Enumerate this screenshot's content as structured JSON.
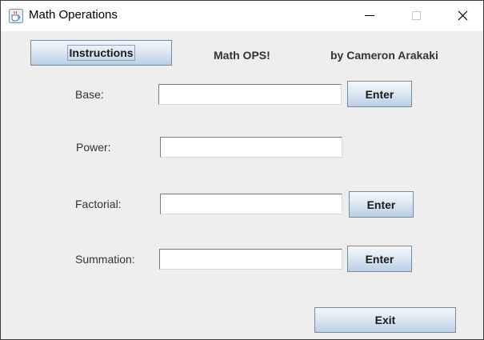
{
  "window": {
    "title": "Math Operations"
  },
  "header": {
    "instructions_label": "Instructions",
    "app_name": "Math OPS!",
    "author": "by Cameron Arakaki"
  },
  "form": {
    "base": {
      "label": "Base:",
      "value": "",
      "button_label": "Enter"
    },
    "power": {
      "label": "Power:",
      "value": ""
    },
    "factorial": {
      "label": "Factorial:",
      "value": "",
      "button_label": "Enter"
    },
    "summation": {
      "label": "Summation:",
      "value": "",
      "button_label": "Enter"
    }
  },
  "footer": {
    "exit_label": "Exit"
  },
  "icons": {
    "app": "java-coffee-cup-icon",
    "minimize": "minimize-icon",
    "maximize": "maximize-icon",
    "close": "close-icon"
  },
  "colors": {
    "window_bg": "#eeeeee",
    "titlebar_bg": "#ffffff",
    "button_gradient_top": "#f3f8fc",
    "button_gradient_bottom": "#b8cfe5",
    "button_border": "#7a8a99"
  }
}
